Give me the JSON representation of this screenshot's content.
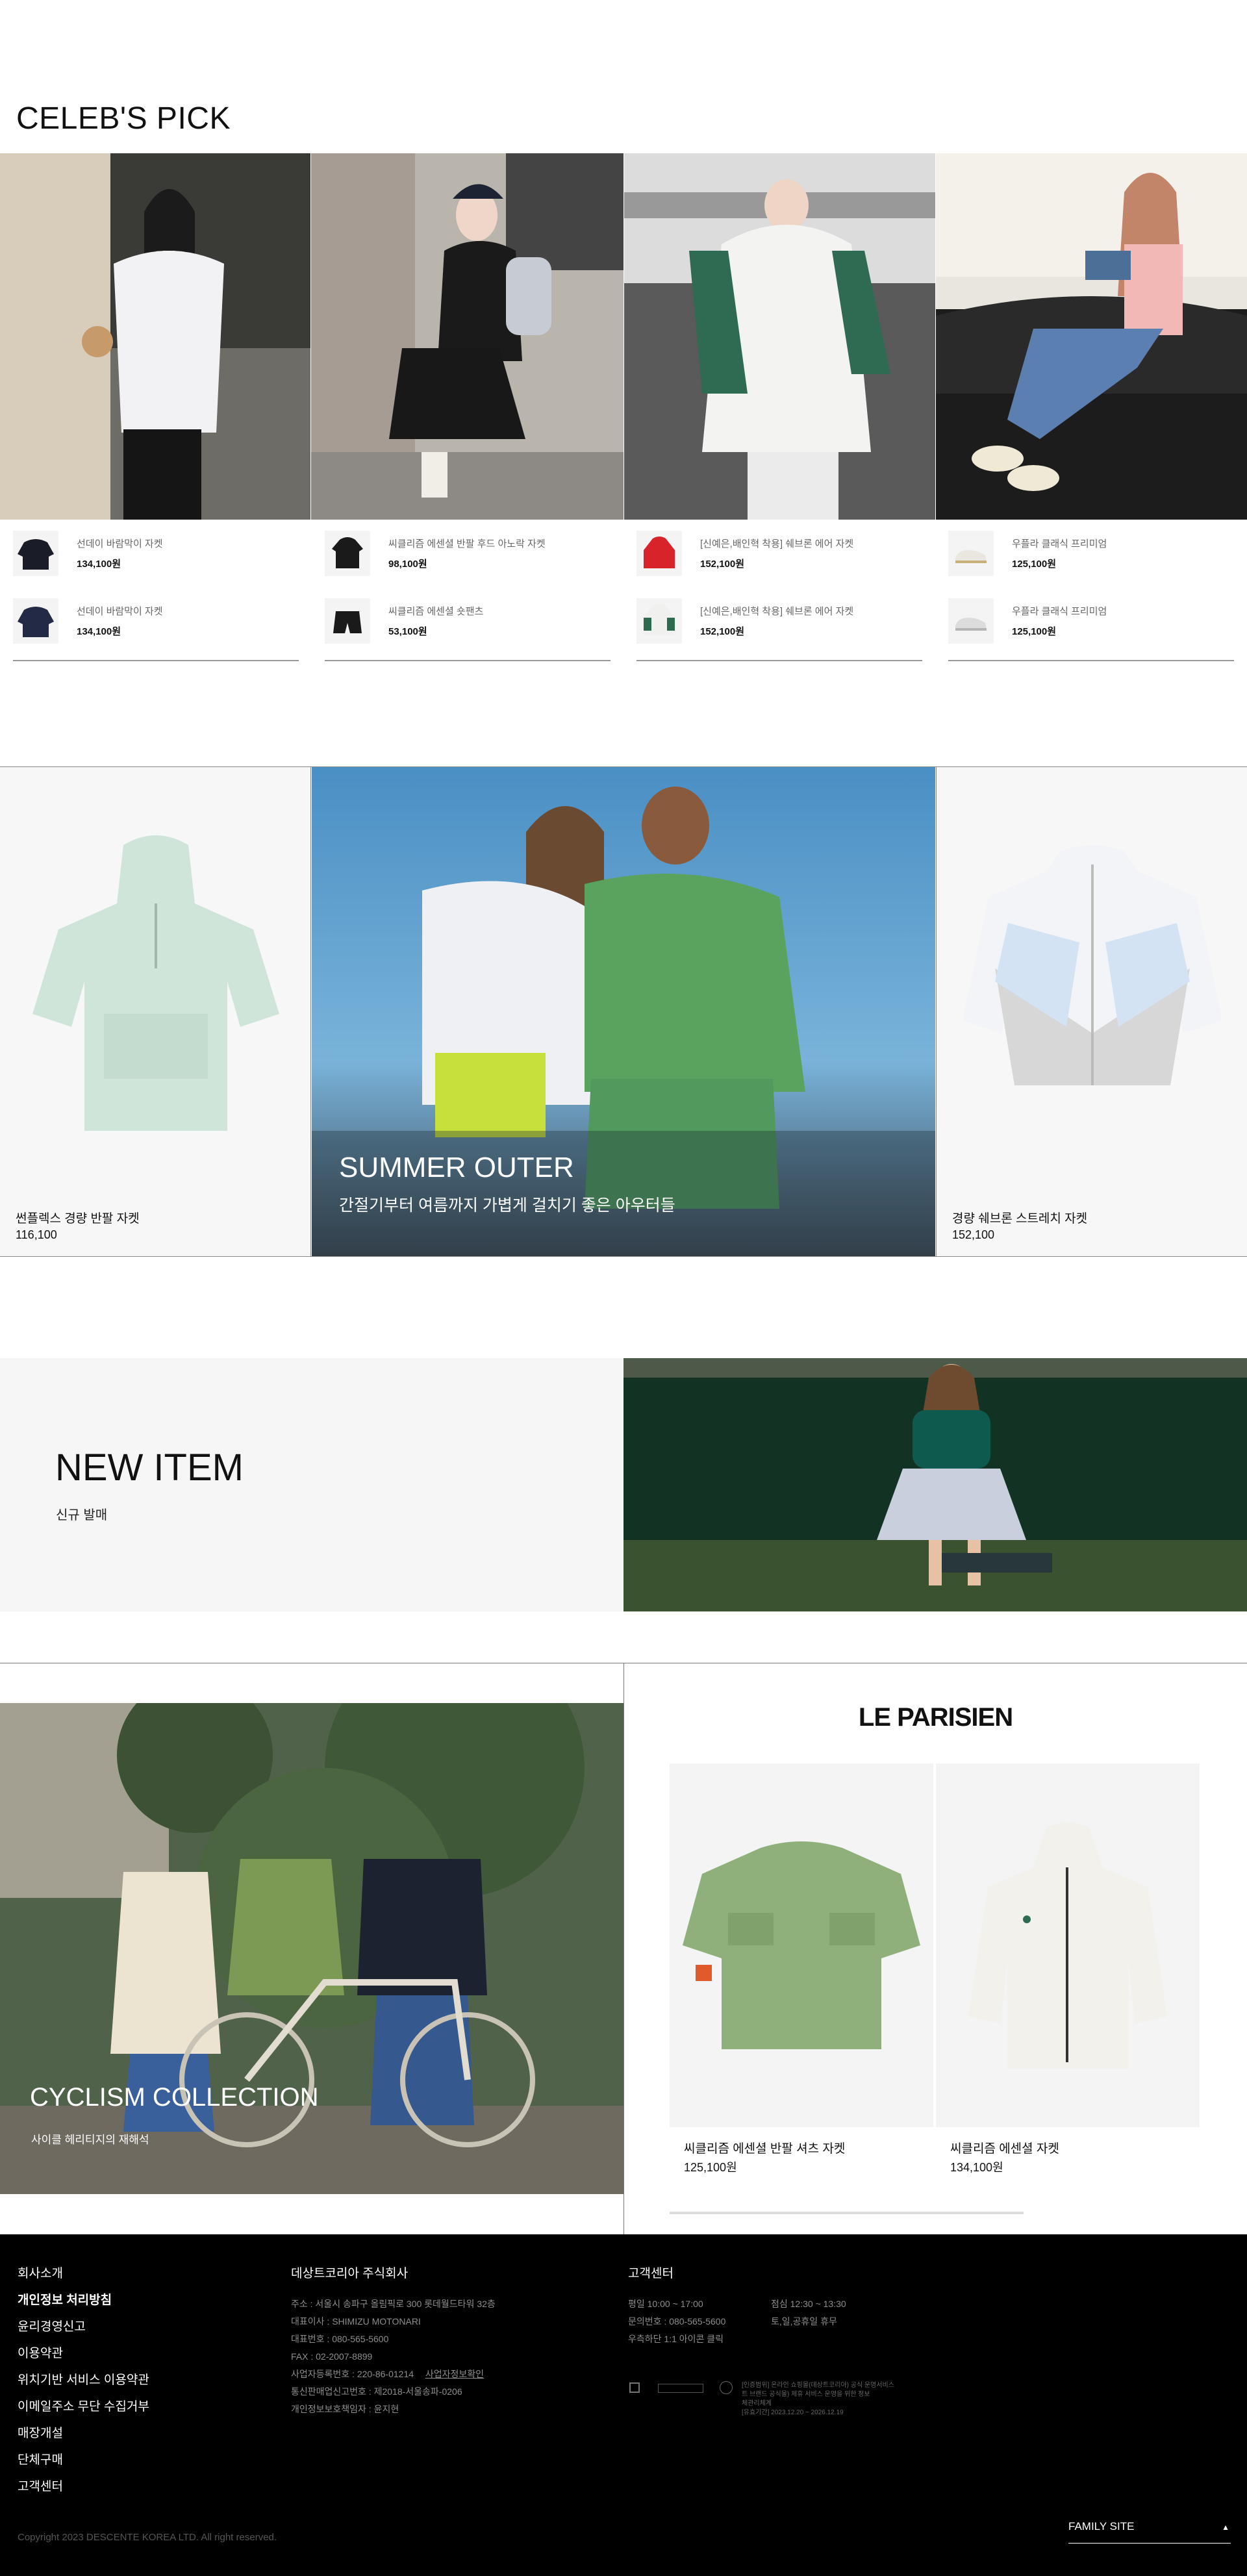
{
  "celebs_pick": {
    "title": "CELEB'S PICK",
    "columns": [
      {
        "items": [
          {
            "name": "선데이 바람막이 자켓",
            "price": "134,100원"
          },
          {
            "name": "선데이 바람막이 자켓",
            "price": "134,100원"
          }
        ]
      },
      {
        "items": [
          {
            "name": "씨클리즘 에센셜 반팔 후드 아노락 자켓",
            "price": "98,100원"
          },
          {
            "name": "씨클리즘 에센셜 숏팬츠",
            "price": "53,100원"
          }
        ]
      },
      {
        "items": [
          {
            "name": "[신예은,배인혁 착용] 쉐브론 에어 자켓",
            "price": "152,100원"
          },
          {
            "name": "[신예은,배인혁 착용] 쉐브론 에어 자켓",
            "price": "152,100원"
          }
        ]
      },
      {
        "items": [
          {
            "name": "우플라 클래식 프리미엄",
            "price": "125,100원"
          },
          {
            "name": "우플라 클래식 프리미엄",
            "price": "125,100원"
          }
        ]
      }
    ]
  },
  "summer": {
    "left_product": {
      "name": "썬플렉스 경량 반팔 자켓",
      "price": "116,100"
    },
    "hero": {
      "title": "SUMMER OUTER",
      "subtitle": "간절기부터 여름까지 가볍게 걸치기 좋은 아우터들"
    },
    "right_product": {
      "name": "경량 쉐브론 스트레치 자켓",
      "price": "152,100"
    }
  },
  "new_item": {
    "title": "NEW ITEM",
    "subtitle": "신규 발매"
  },
  "cyclism": {
    "title": "CYCLISM COLLECTION",
    "subtitle": "사이클 헤리티지의 재해석"
  },
  "le_parisien": {
    "title": "LE PARISIEN",
    "products": [
      {
        "name": "씨클리즘 에센셜 반팔 셔츠 자켓",
        "price": "125,100원"
      },
      {
        "name": "씨클리즘 에센셜 자켓",
        "price": "134,100원"
      }
    ]
  },
  "footer": {
    "links": [
      "회사소개",
      "개인정보 처리방침",
      "윤리경영신고",
      "이용약관",
      "위치기반 서비스 이용약관",
      "이메일주소 무단 수집거부",
      "매장개설",
      "단체구매",
      "고객센터"
    ],
    "company": {
      "name": "데상트코리아 주식회사",
      "lines": [
        "주소 : 서울시 송파구 올림픽로 300 롯데월드타워 32층",
        "대표이사 : SHIMIZU MOTONARI",
        "대표번호 : 080-565-5600",
        "FAX : 02-2007-8899",
        "사업자등록번호 : 220-86-01214",
        "통신판매업신고번호 : 제2018-서울송파-0206",
        "개인정보보호책임자 : 윤지현"
      ],
      "biz_link": "사업자정보확인"
    },
    "cs": {
      "title": "고객센터",
      "hours_label": "평일 10:00 ~ 17:00",
      "lunch_label": "점심 12:30 ~ 13:30",
      "phone_label": "문의번호 : 080-565-5600",
      "closed_label": "토,일,공휴일 휴무",
      "kakao_label": "우측하단 1:1 아이콘 클릭"
    },
    "cert_lines": [
      "[인증범위] 온라인 쇼핑몰(데상트코리아) 공식 운영서비스",
      "트 브랜드 공식몰) 제휴 서비스 운영을 위한 정보",
      "체관리체계",
      "[유효기간] 2023.12.20 ~ 2026.12.19"
    ],
    "copyright": "Copyright 2023 DESCENTE KOREA LTD. All right reserved.",
    "family_site": "FAMILY SITE"
  }
}
